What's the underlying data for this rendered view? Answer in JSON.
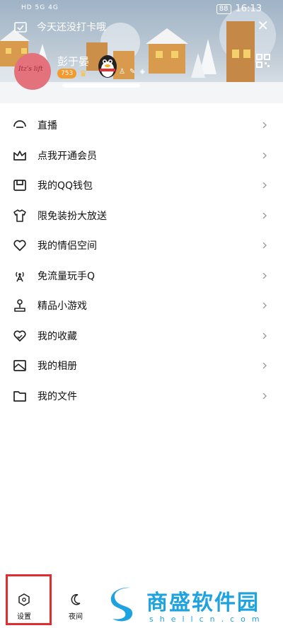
{
  "status_bar": {
    "network": "HD 5G 4G",
    "time": "16:13",
    "battery": "88"
  },
  "header": {
    "checkin_text": "今天还没打卡哦",
    "nickname": "彭于晏",
    "level_badge": "753",
    "avatar_text": "Itz's lift"
  },
  "menu": {
    "items": [
      {
        "label": "直播",
        "icon": "live-icon"
      },
      {
        "label": "点我开通会员",
        "icon": "crown-icon"
      },
      {
        "label": "我的QQ钱包",
        "icon": "wallet-icon"
      },
      {
        "label": "限免装扮大放送",
        "icon": "shirt-icon"
      },
      {
        "label": "我的情侣空间",
        "icon": "heart-icon"
      },
      {
        "label": "免流量玩手Q",
        "icon": "antenna-icon"
      },
      {
        "label": "精品小游戏",
        "icon": "joystick-icon"
      },
      {
        "label": "我的收藏",
        "icon": "heart-star-icon"
      },
      {
        "label": "我的相册",
        "icon": "album-icon"
      },
      {
        "label": "我的文件",
        "icon": "folder-icon"
      }
    ]
  },
  "bottom": {
    "settings_label": "设置",
    "night_label": "夜间",
    "watermark_name": "商盛软件园",
    "watermark_url": "shellcn.com"
  },
  "colors": {
    "highlight_border": "#e02c2c",
    "watermark": "#1ea2e0",
    "level_badge": "#f29a2e"
  }
}
